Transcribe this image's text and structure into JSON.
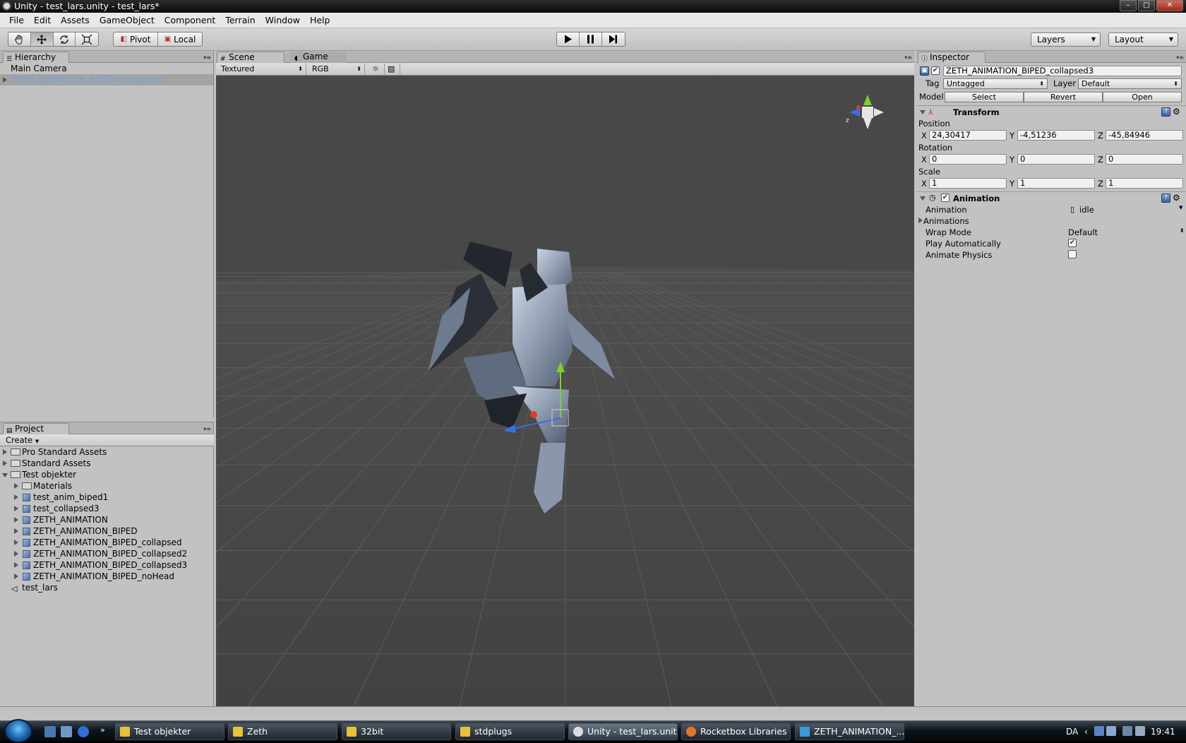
{
  "window": {
    "title": "Unity - test_lars.unity - test_lars*"
  },
  "menu": [
    "File",
    "Edit",
    "Assets",
    "GameObject",
    "Component",
    "Terrain",
    "Window",
    "Help"
  ],
  "toolbar": {
    "pivot": "Pivot",
    "local": "Local",
    "layers": "Layers",
    "layout": "Layout",
    "play_icon": "play-icon",
    "pause_icon": "pause-icon",
    "step_icon": "step-icon"
  },
  "hierarchy": {
    "tab": "Hierarchy",
    "items": [
      {
        "label": "Main Camera",
        "selected": false
      },
      {
        "label": "ZETH_ANIMATION_BIPED_collapsed3",
        "selected": true
      }
    ]
  },
  "project": {
    "tab": "Project",
    "create": "Create",
    "items": [
      {
        "label": "Pro Standard Assets",
        "type": "folder",
        "depth": 0,
        "expanded": false
      },
      {
        "label": "Standard Assets",
        "type": "folder",
        "depth": 0,
        "expanded": false
      },
      {
        "label": "Test objekter",
        "type": "folder",
        "depth": 0,
        "expanded": true
      },
      {
        "label": "Materials",
        "type": "folder",
        "depth": 1,
        "expanded": false
      },
      {
        "label": "test_anim_biped1",
        "type": "prefab",
        "depth": 1,
        "expanded": false
      },
      {
        "label": "test_collapsed3",
        "type": "prefab",
        "depth": 1,
        "expanded": false
      },
      {
        "label": "ZETH_ANIMATION",
        "type": "prefab",
        "depth": 1,
        "expanded": false
      },
      {
        "label": "ZETH_ANIMATION_BIPED",
        "type": "prefab",
        "depth": 1,
        "expanded": false
      },
      {
        "label": "ZETH_ANIMATION_BIPED_collapsed",
        "type": "prefab",
        "depth": 1,
        "expanded": false
      },
      {
        "label": "ZETH_ANIMATION_BIPED_collapsed2",
        "type": "prefab",
        "depth": 1,
        "expanded": false
      },
      {
        "label": "ZETH_ANIMATION_BIPED_collapsed3",
        "type": "prefab",
        "depth": 1,
        "expanded": false
      },
      {
        "label": "ZETH_ANIMATION_BIPED_noHead",
        "type": "prefab",
        "depth": 1,
        "expanded": false
      },
      {
        "label": "test_lars",
        "type": "scene",
        "depth": 0,
        "expanded": false
      }
    ]
  },
  "scene": {
    "tab_scene": "Scene",
    "tab_game": "Game",
    "render_mode": "Textured",
    "color_mode": "RGB",
    "gizmo_axis_label": "z"
  },
  "inspector": {
    "tab": "Inspector",
    "object_name": "ZETH_ANIMATION_BIPED_collapsed3",
    "tag_label": "Tag",
    "tag_value": "Untagged",
    "layer_label": "Layer",
    "layer_value": "Default",
    "model_label": "Model",
    "model_buttons": [
      "Select",
      "Revert",
      "Open"
    ],
    "transform": {
      "title": "Transform",
      "position_label": "Position",
      "rotation_label": "Rotation",
      "scale_label": "Scale",
      "axes": [
        "X",
        "Y",
        "Z"
      ],
      "position": [
        "24,30417",
        "-4,51236",
        "-45,84946"
      ],
      "rotation": [
        "0",
        "0",
        "0"
      ],
      "scale": [
        "1",
        "1",
        "1"
      ]
    },
    "animation": {
      "title": "Animation",
      "animation_label": "Animation",
      "animation_value": "idle",
      "animations_label": "Animations",
      "wrap_mode_label": "Wrap Mode",
      "wrap_mode_value": "Default",
      "play_auto_label": "Play Automatically",
      "play_auto_checked": true,
      "animate_physics_label": "Animate Physics",
      "animate_physics_checked": false
    }
  },
  "taskbar": {
    "buttons": [
      "Test objekter",
      "Zeth",
      "32bit",
      "stdplugs",
      "Unity - test_lars.unit...",
      "Rocketbox Libraries ...",
      "ZETH_ANIMATION_..."
    ],
    "language": "DA",
    "time": "19:41"
  },
  "colors": {
    "viewport_bg": "#4a4a4a",
    "selection_text": "#6fa3e0",
    "grid_line": "#5a5a5a"
  }
}
